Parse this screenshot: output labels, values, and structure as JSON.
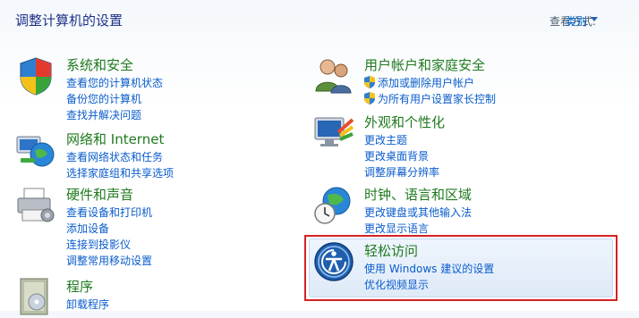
{
  "page": {
    "title": "调整计算机的设置",
    "view_by_label": "查看方式:",
    "view_by_value": "类别"
  },
  "categories": {
    "system": {
      "title": "系统和安全",
      "links": [
        "查看您的计算机状态",
        "备份您的计算机",
        "查找并解决问题"
      ]
    },
    "network": {
      "title": "网络和 Internet",
      "links": [
        "查看网络状态和任务",
        "选择家庭组和共享选项"
      ]
    },
    "hardware": {
      "title": "硬件和声音",
      "links": [
        "查看设备和打印机",
        "添加设备",
        "连接到投影仪",
        "调整常用移动设置"
      ]
    },
    "programs": {
      "title": "程序",
      "links": [
        "卸载程序"
      ]
    },
    "users": {
      "title": "用户帐户和家庭安全",
      "links": [
        "添加或删除用户帐户",
        "为所有用户设置家长控制"
      ]
    },
    "appearance": {
      "title": "外观和个性化",
      "links": [
        "更改主题",
        "更改桌面背景",
        "调整屏幕分辨率"
      ]
    },
    "clock": {
      "title": "时钟、语言和区域",
      "links": [
        "更改键盘或其他输入法",
        "更改显示语言"
      ]
    },
    "ease": {
      "title": "轻松访问",
      "links": [
        "使用 Windows 建议的设置",
        "优化视频显示"
      ]
    }
  },
  "colors": {
    "category_title": "#1f7a1f",
    "link": "#0a5ccc",
    "highlight_border": "#d42222"
  }
}
